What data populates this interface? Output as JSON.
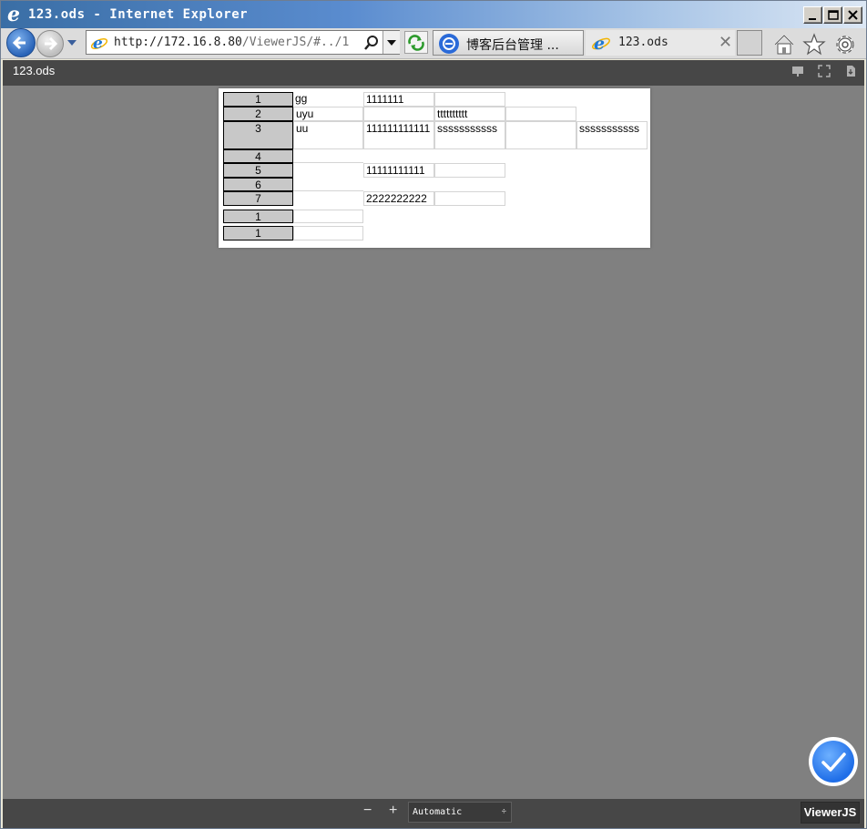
{
  "window": {
    "title": "123.ods - Internet Explorer"
  },
  "navbar": {
    "url_host": "http://172.16.8.80",
    "url_path": "/ViewerJS/#../1",
    "tabs": [
      {
        "label": "博客后台管理 ...",
        "icon": "blog-site-icon"
      },
      {
        "label": "123.ods",
        "icon": "ie-icon"
      }
    ],
    "close_tab_glyph": "✕"
  },
  "viewer": {
    "doc_title": "123.ods",
    "zoom_out_glyph": "−",
    "zoom_in_glyph": "+",
    "zoom_value": "Automatic",
    "zoom_caret": "÷",
    "brand": "ViewerJS"
  },
  "sheet": {
    "rows": [
      {
        "header": "1",
        "cells": [
          "gg",
          "1111111",
          "",
          ""
        ]
      },
      {
        "header": "2",
        "cells": [
          "uyu",
          "",
          "tttttttttt",
          ""
        ]
      },
      {
        "header": "3",
        "cells": [
          "uu",
          "111111111111",
          "sssssssssss",
          "",
          "sssssssssss"
        ]
      },
      {
        "header": "4",
        "cells": [
          ""
        ]
      },
      {
        "header": "5",
        "cells": [
          "",
          "11111111111",
          ""
        ]
      },
      {
        "header": "6",
        "cells": [
          ""
        ]
      },
      {
        "header": "7",
        "cells": [
          "",
          "2222222222",
          ""
        ]
      }
    ],
    "extra_rows": [
      {
        "header": "1",
        "cells": [
          ""
        ]
      },
      {
        "header": "1",
        "cells": [
          ""
        ]
      }
    ]
  },
  "colors": {
    "viewer_background": "#808080",
    "toolbar": "#474747",
    "row_header": "#c8c8c8",
    "fab_accent": "#1f6ee8"
  }
}
